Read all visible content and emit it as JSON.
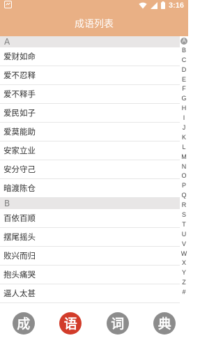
{
  "status_bar": {
    "time": "3:16"
  },
  "app_bar": {
    "title": "成语列表"
  },
  "sections": [
    {
      "letter": "A",
      "items": [
        "爱财如命",
        "爱不忍释",
        "爱不释手",
        "爱民如子",
        "爱莫能助",
        "安家立业",
        "安分守己",
        "暗渡陈仓"
      ]
    },
    {
      "letter": "B",
      "items": [
        "百依百顺",
        "摆尾摇头",
        "败兴而归",
        "抱头痛哭",
        "逼人太甚"
      ]
    }
  ],
  "index_bar": {
    "letters": [
      "A",
      "B",
      "C",
      "D",
      "E",
      "F",
      "G",
      "H",
      "I",
      "J",
      "K",
      "L",
      "M",
      "N",
      "O",
      "P",
      "Q",
      "R",
      "S",
      "T",
      "U",
      "V",
      "W",
      "X",
      "Y",
      "Z",
      "#"
    ],
    "active": "A"
  },
  "bottom_nav": {
    "items": [
      {
        "label": "成",
        "active": false
      },
      {
        "label": "语",
        "active": true
      },
      {
        "label": "词",
        "active": false
      },
      {
        "label": "典",
        "active": false
      }
    ],
    "active_color": "#d23c2a",
    "inactive_color": "#8c8c8c"
  },
  "colors": {
    "accent": "#e9b085"
  }
}
